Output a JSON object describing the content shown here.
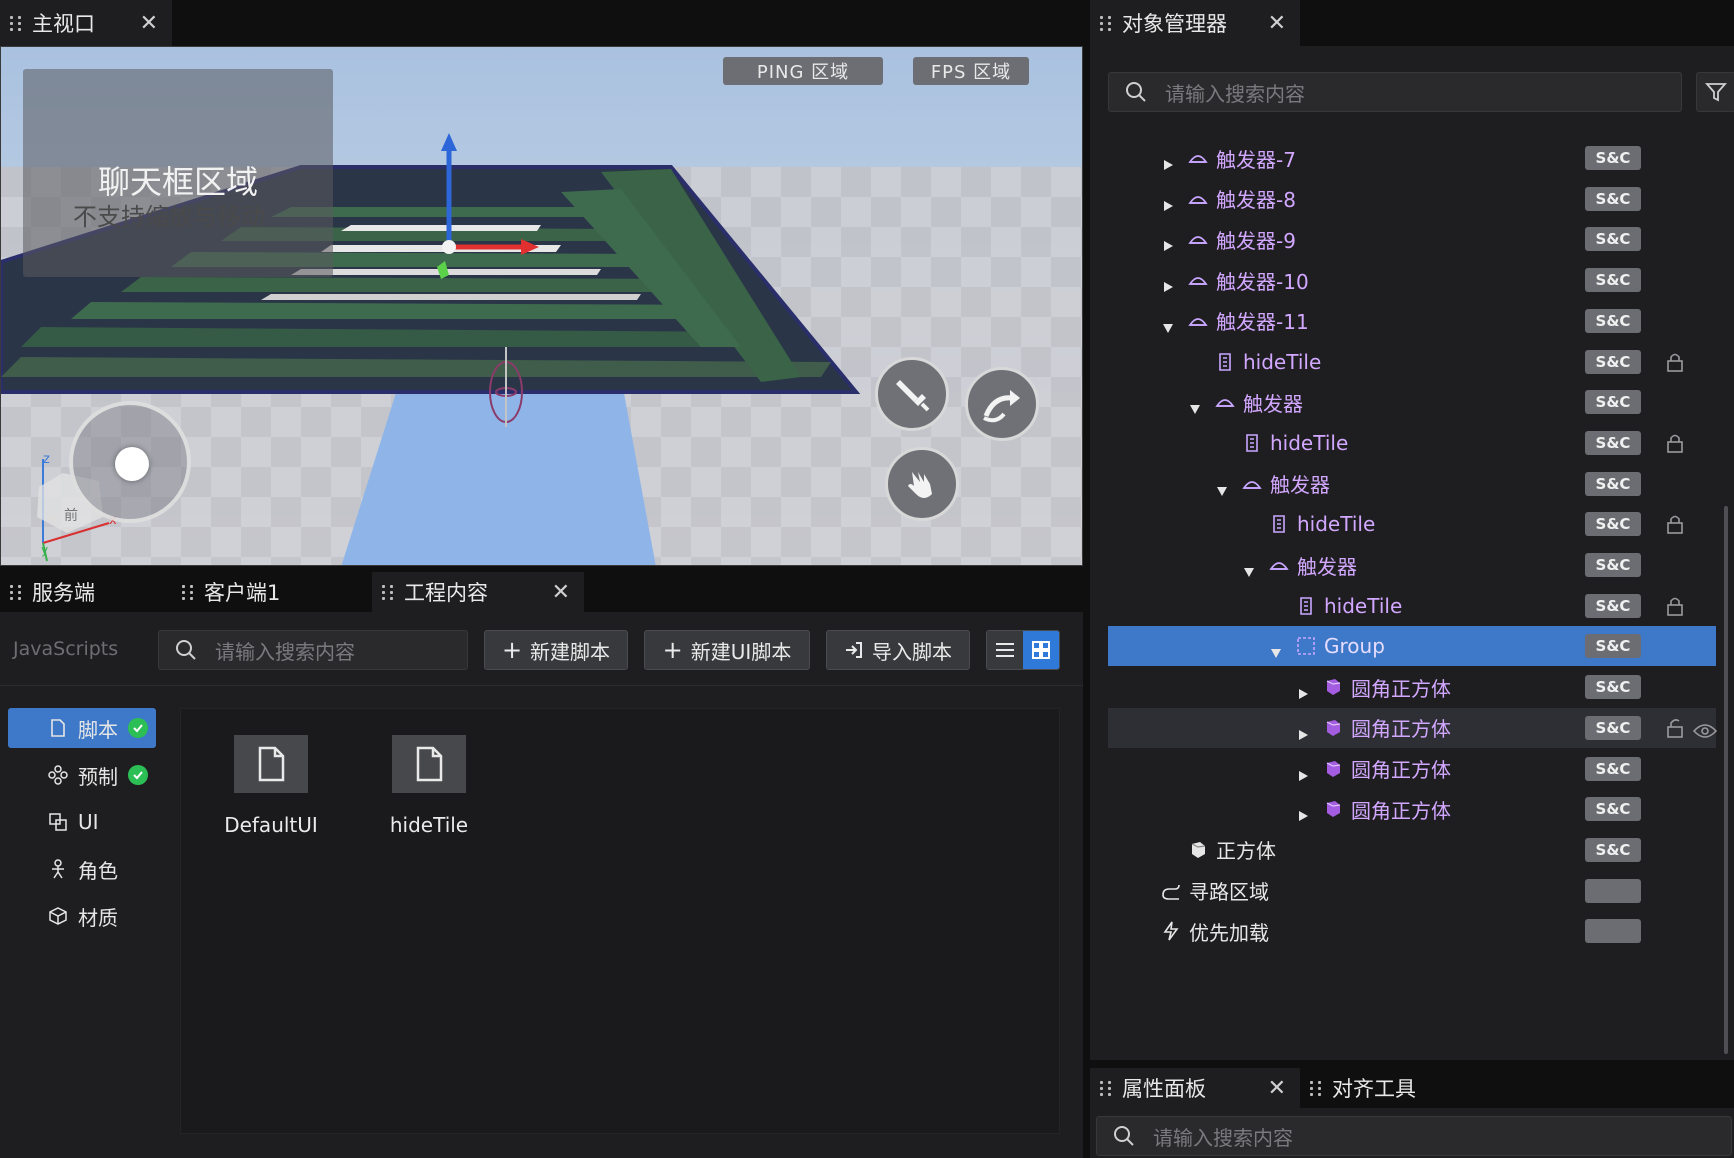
{
  "viewport_tab": {
    "label": "主视口",
    "close": "✕"
  },
  "viewport": {
    "ping_label": "PING 区域",
    "fps_label": "FPS 区域",
    "chat_title": "聊天框区域",
    "chat_subtitle": "不支持缩放与移动",
    "axis_x": "x",
    "axis_z": "z",
    "axis_y": "y",
    "gizmo_front": "前"
  },
  "bottom_tabs": [
    {
      "label": "服务端"
    },
    {
      "label": "客户端1"
    },
    {
      "label": "工程内容",
      "close": "✕"
    }
  ],
  "project": {
    "category_label": "JavaScripts",
    "search_placeholder": "请输入搜索内容",
    "buttons": {
      "new_script": "新建脚本",
      "new_ui_script": "新建UI脚本",
      "import_script": "导入脚本"
    },
    "categories": [
      {
        "label": "脚本",
        "icon": "file-icon",
        "checked": true
      },
      {
        "label": "预制",
        "icon": "prefab-icon",
        "checked": true
      },
      {
        "label": "UI",
        "icon": "ui-icon",
        "checked": false
      },
      {
        "label": "角色",
        "icon": "character-icon",
        "checked": false
      },
      {
        "label": "材质",
        "icon": "cube-icon",
        "checked": false
      }
    ],
    "files": [
      {
        "name": "DefaultUI",
        "icon": "file-icon"
      },
      {
        "name": "hideTile",
        "icon": "file-icon"
      }
    ]
  },
  "object_manager": {
    "tab_label": "对象管理器",
    "close": "✕",
    "search_placeholder": "请输入搜索内容",
    "rows": [
      {
        "label": "触发器-7",
        "badge": "S&C"
      },
      {
        "label": "触发器-8",
        "badge": "S&C"
      },
      {
        "label": "触发器-9",
        "badge": "S&C"
      },
      {
        "label": "触发器-10",
        "badge": "S&C"
      },
      {
        "label": "触发器-11",
        "badge": "S&C"
      },
      {
        "label": "hideTile",
        "badge": "S&C"
      },
      {
        "label": "触发器",
        "badge": "S&C"
      },
      {
        "label": "hideTile",
        "badge": "S&C"
      },
      {
        "label": "触发器",
        "badge": "S&C"
      },
      {
        "label": "hideTile",
        "badge": "S&C"
      },
      {
        "label": "触发器",
        "badge": "S&C"
      },
      {
        "label": "hideTile",
        "badge": "S&C"
      },
      {
        "label": "Group",
        "badge": "S&C"
      },
      {
        "label": "圆角正方体",
        "badge": "S&C"
      },
      {
        "label": "圆角正方体",
        "badge": "S&C"
      },
      {
        "label": "圆角正方体",
        "badge": "S&C"
      },
      {
        "label": "圆角正方体",
        "badge": "S&C"
      },
      {
        "label": "正方体",
        "badge": "S&C"
      },
      {
        "label": "寻路区域"
      },
      {
        "label": "优先加载"
      }
    ]
  },
  "attr_tabs": [
    {
      "label": "属性面板",
      "close": "✕"
    },
    {
      "label": "对齐工具"
    }
  ],
  "attr": {
    "search_placeholder": "请输入搜索内容"
  },
  "colors": {
    "accent": "#3d79c8",
    "tree_label": "#d2a7ff",
    "badge": "#6b6d72",
    "check": "#2cbf55"
  }
}
